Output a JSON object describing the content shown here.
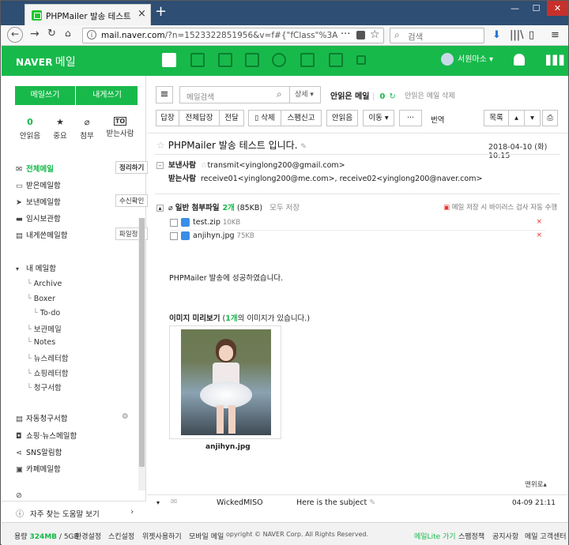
{
  "browser": {
    "tab_title": "PHPMailer 발송 테스트 입니다",
    "tab_close": "×",
    "new_tab": "+",
    "url_domain": "mail.naver.com",
    "url_path": "/?n=1523322851956&v=f#{\"fClass\"%3A\"read\"",
    "url_more": "···",
    "search_placeholder": "검색",
    "window_min": "—",
    "window_max": "☐",
    "window_close": "✕"
  },
  "header": {
    "logo": "NAVER",
    "app": "메일",
    "user": "서원마소"
  },
  "sidebar": {
    "compose": "메일쓰기",
    "compose_self": "내게쓰기",
    "quick": [
      {
        "count": "0",
        "label": "안읽음"
      },
      {
        "count": "",
        "label": "중요"
      },
      {
        "count": "",
        "label": "첨부"
      },
      {
        "count": "",
        "label": "받는사람"
      }
    ],
    "folders": [
      {
        "label": "전체메일",
        "button": "정리하기"
      },
      {
        "label": "받은메일함",
        "button": ""
      },
      {
        "label": "보낸메일함",
        "button": "수신확인"
      },
      {
        "label": "임시보관함",
        "button": ""
      },
      {
        "label": "내게쓴메일함",
        "button": "파일정부"
      }
    ],
    "my_folders": "내 메일함",
    "subfolders": [
      "Archive",
      "Boxer",
      "To-do",
      "보관메일",
      "Notes",
      "뉴스레터함",
      "쇼핑레터함",
      "청구서함"
    ],
    "extra": [
      "자동청구서함",
      "쇼핑·뉴스메일함",
      "SNS알림함",
      "카페메일함"
    ],
    "help": "자주 찾는 도움말 보기"
  },
  "toolbar": {
    "search_placeholder": "메일검색",
    "detail": "상세",
    "unread_only": "안읽은 메일",
    "unread_count": "0",
    "delete_unread": "안읽은 메일 삭제",
    "actions": [
      "답장",
      "전체답장",
      "전달",
      "삭제",
      "스팸신고",
      "안읽음",
      "이동",
      "···",
      "번역"
    ],
    "list": "목록"
  },
  "mail": {
    "subject": "PHPMailer 발송 테스트 입니다.",
    "date": "2018-04-10 (화) 10:15",
    "from_label": "보낸사람",
    "from": "transmit<yinglong200@gmail.com>",
    "to_label": "받는사람",
    "to": "receive01<yinglong200@me.com>, receive02<yinglong200@naver.com>",
    "attach_title": "일반 첨부파일",
    "attach_count": "2개",
    "attach_size": "(85KB)",
    "save_all": "모두 저장",
    "virus_note": "메일 저장 시 바이러스 검사 자동 수행",
    "attachments": [
      {
        "name": "test.zip",
        "size": "10KB"
      },
      {
        "name": "anjihyn.jpg",
        "size": "75KB"
      }
    ],
    "body": "PHPMailer 발송에 성공하였습니다.",
    "preview_title": "이미지 미리보기",
    "preview_count": "1개",
    "preview_suffix": "의 이미지가 있습니다.",
    "image_caption": "anjihyn.jpg",
    "to_top": "맨위로",
    "prev": {
      "sender": "WickedMISO",
      "subject": "Here is the subject",
      "date": "04-09 21:11"
    }
  },
  "footer": {
    "usage_label": "용량",
    "usage": "324MB",
    "quota": "/ 5GB",
    "links": [
      "환경설정",
      "스킨설정",
      "위젯사용하기",
      "모바일 메일"
    ],
    "copyright": "opyright © NAVER Corp. All Rights Reserved.",
    "right": [
      "메일Lite 가기",
      "스팸정책",
      "공지사항",
      "메일 고객센터"
    ]
  },
  "colors": {
    "brand": "#18b94b",
    "titlebar": "#2e4e73"
  }
}
